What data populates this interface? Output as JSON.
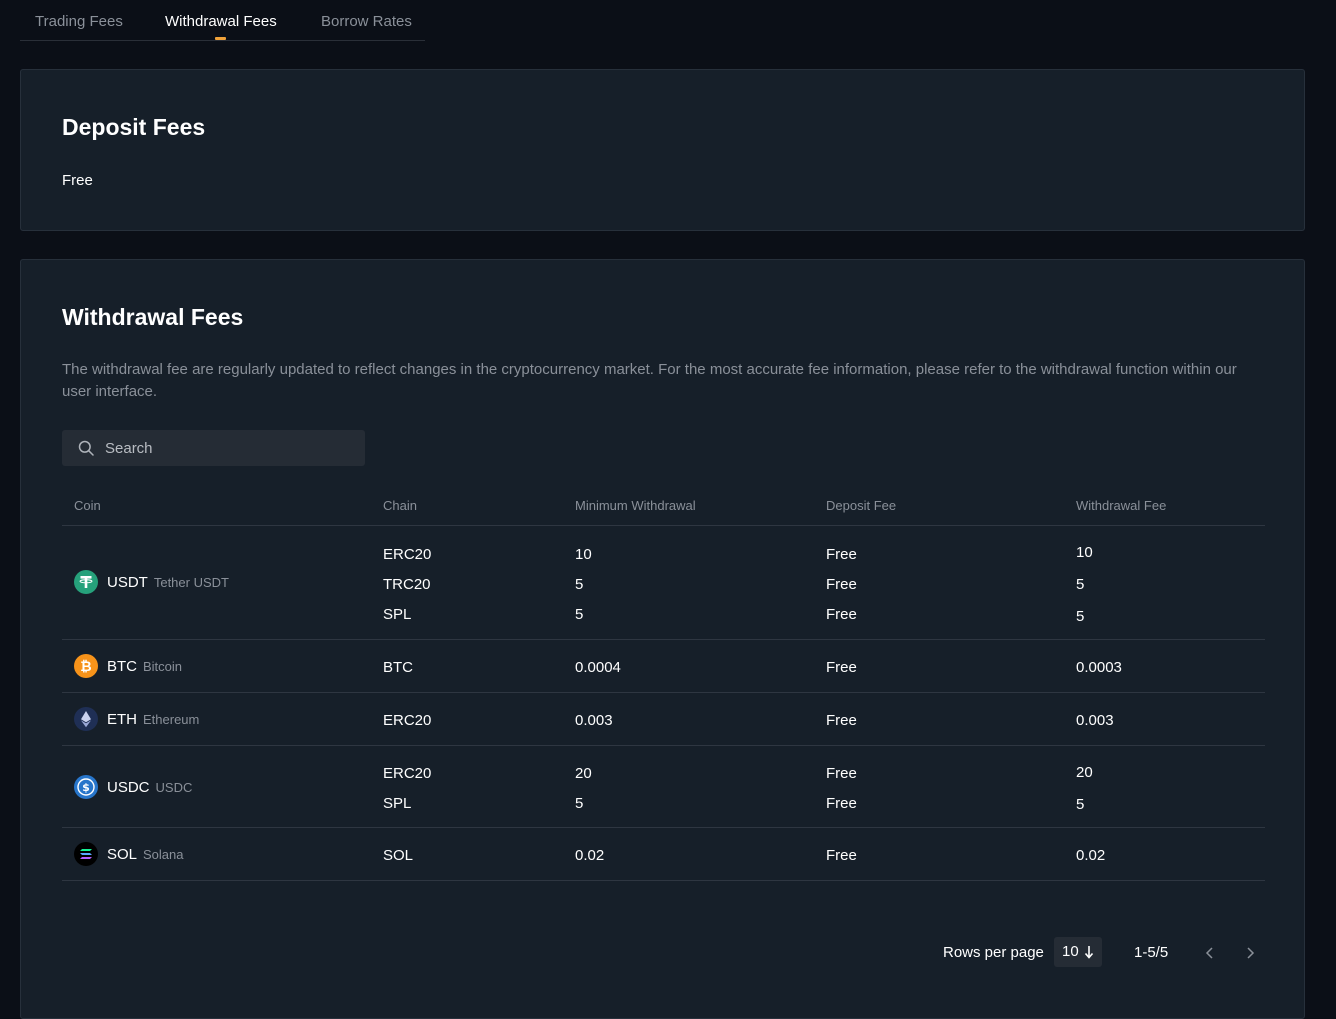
{
  "tabs": [
    {
      "label": "Trading Fees"
    },
    {
      "label": "Withdrawal Fees"
    },
    {
      "label": "Borrow Rates"
    }
  ],
  "deposit": {
    "title": "Deposit Fees",
    "value": "Free"
  },
  "withdraw": {
    "title": "Withdrawal Fees",
    "description": "The withdrawal fee are regularly updated to reflect changes in the cryptocurrency market. For the most accurate fee information, please refer to the withdrawal function within our user interface.",
    "search_placeholder": "Search",
    "columns": [
      "Coin",
      "Chain",
      "Minimum Withdrawal",
      "Deposit Fee",
      "Withdrawal Fee"
    ],
    "rows": [
      {
        "symbol": "USDT",
        "name": "Tether USDT",
        "icon": "tether-icon",
        "color": "#26a17b",
        "chains": [
          {
            "chain": "ERC20",
            "min": "10",
            "deposit_fee": "Free",
            "withdraw_fee": "10"
          },
          {
            "chain": "TRC20",
            "min": "5",
            "deposit_fee": "Free",
            "withdraw_fee": "5"
          },
          {
            "chain": "SPL",
            "min": "5",
            "deposit_fee": "Free",
            "withdraw_fee": "5"
          }
        ]
      },
      {
        "symbol": "BTC",
        "name": "Bitcoin",
        "icon": "bitcoin-icon",
        "color": "#f7931a",
        "chains": [
          {
            "chain": "BTC",
            "min": "0.0004",
            "deposit_fee": "Free",
            "withdraw_fee": "0.0003"
          }
        ]
      },
      {
        "symbol": "ETH",
        "name": "Ethereum",
        "icon": "ethereum-icon",
        "color": "#1f2f55",
        "chains": [
          {
            "chain": "ERC20",
            "min": "0.003",
            "deposit_fee": "Free",
            "withdraw_fee": "0.003"
          }
        ]
      },
      {
        "symbol": "USDC",
        "name": "USDC",
        "icon": "usdc-icon",
        "color": "#2775ca",
        "chains": [
          {
            "chain": "ERC20",
            "min": "20",
            "deposit_fee": "Free",
            "withdraw_fee": "20"
          },
          {
            "chain": "SPL",
            "min": "5",
            "deposit_fee": "Free",
            "withdraw_fee": "5"
          }
        ]
      },
      {
        "symbol": "SOL",
        "name": "Solana",
        "icon": "solana-icon",
        "color": "#000000",
        "chains": [
          {
            "chain": "SOL",
            "min": "0.02",
            "deposit_fee": "Free",
            "withdraw_fee": "0.02"
          }
        ]
      }
    ]
  },
  "pagination": {
    "rows_per_page_label": "Rows per page",
    "rows_per_page": "10",
    "range": "1-5/5"
  },
  "colors": {
    "accent": "#f0a23a",
    "background": "#0b0f17",
    "card": "#161f29"
  }
}
